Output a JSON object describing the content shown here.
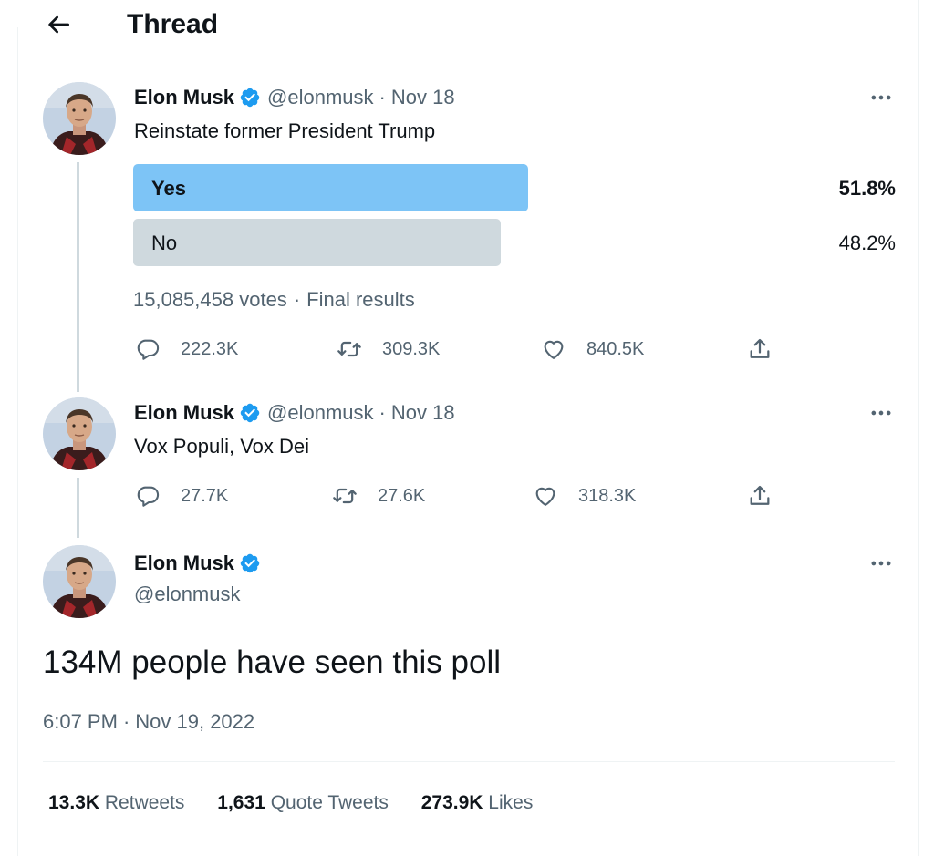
{
  "header": {
    "title": "Thread"
  },
  "tweets": [
    {
      "name": "Elon Musk",
      "handle": "@elonmusk",
      "date": "Nov 18",
      "text": "Reinstate former President Trump",
      "poll": {
        "options": [
          {
            "label": "Yes",
            "percent": "51.8%",
            "share": 0.518,
            "winner": true
          },
          {
            "label": "No",
            "percent": "48.2%",
            "share": 0.482,
            "winner": false
          }
        ],
        "votes": "15,085,458 votes",
        "status": "Final results"
      },
      "replies": "222.3K",
      "retweets": "309.3K",
      "likes": "840.5K"
    },
    {
      "name": "Elon Musk",
      "handle": "@elonmusk",
      "date": "Nov 18",
      "text": "Vox Populi, Vox Dei",
      "replies": "27.7K",
      "retweets": "27.6K",
      "likes": "318.3K"
    }
  ],
  "focus": {
    "name": "Elon Musk",
    "handle": "@elonmusk",
    "text": "134M people have seen this poll",
    "time": "6:07 PM",
    "date": "Nov 19, 2022",
    "stats": {
      "retweets_count": "13.3K",
      "retweets_label": "Retweets",
      "quotes_count": "1,631",
      "quotes_label": "Quote Tweets",
      "likes_count": "273.9K",
      "likes_label": "Likes"
    }
  },
  "icons": {
    "back": "arrow-left-icon",
    "verified": "verified-badge-icon",
    "more": "more-horizontal-icon",
    "reply": "reply-icon",
    "retweet": "retweet-icon",
    "like": "heart-icon",
    "share": "share-icon"
  },
  "colors": {
    "poll_winner": "#7dc4f6",
    "poll_other": "#cfd9de",
    "verified": "#1d9bf0",
    "secondary_text": "#536471",
    "thread_line": "#cfd9de"
  }
}
